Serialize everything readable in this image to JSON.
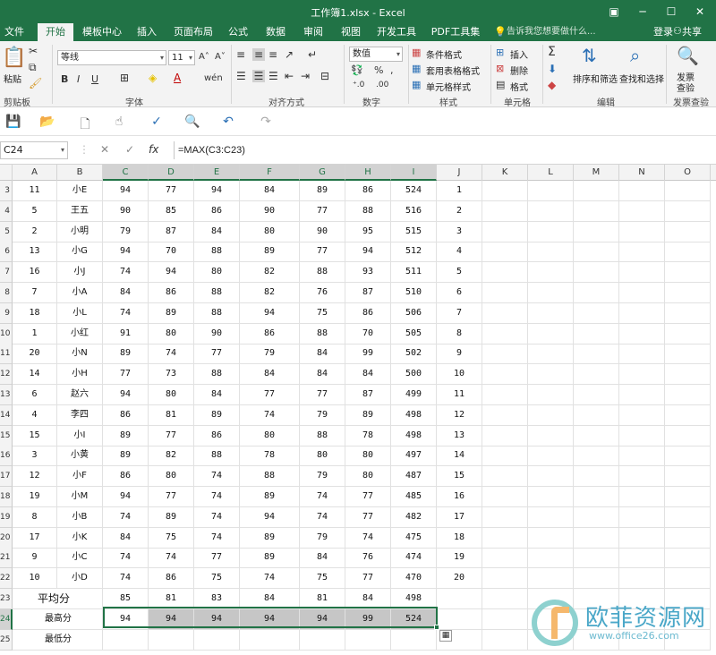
{
  "window": {
    "title": "工作簿1.xlsx - Excel",
    "controls": [
      "▣",
      "─",
      "☐",
      "✕"
    ]
  },
  "ribbon_tabs": [
    "文件",
    "开始",
    "模板中心",
    "插入",
    "页面布局",
    "公式",
    "数据",
    "审阅",
    "视图",
    "开发工具",
    "PDF工具集"
  ],
  "active_tab": "开始",
  "tell_me": "告诉我您想要做什么...",
  "login": "登录",
  "share": "共享",
  "ribbon": {
    "clipboard": {
      "label": "剪贴板",
      "paste": "粘贴"
    },
    "font": {
      "label": "字体",
      "name": "等线",
      "size": "11"
    },
    "alignment": {
      "label": "对齐方式"
    },
    "number": {
      "label": "数字",
      "format": "数值"
    },
    "styles": {
      "label": "样式",
      "conditional": "条件格式",
      "table": "套用表格格式",
      "cell": "单元格样式"
    },
    "cells": {
      "label": "单元格",
      "insert": "插入",
      "delete": "删除",
      "format": "格式"
    },
    "editing": {
      "label": "编辑",
      "sort": "排序和筛选",
      "find": "查找和选择"
    },
    "invoice": {
      "label": "发票查验",
      "btn_line1": "发票",
      "btn_line2": "查验"
    }
  },
  "formula_bar": {
    "name_box": "C24",
    "formula": "=MAX(C3:C23)"
  },
  "columns": [
    "A",
    "B",
    "C",
    "D",
    "E",
    "F",
    "G",
    "H",
    "I",
    "J",
    "K",
    "L",
    "M",
    "N",
    "O"
  ],
  "selected_columns": [
    "C",
    "D",
    "E",
    "F",
    "G",
    "H",
    "I"
  ],
  "rows": [
    {
      "num": "3",
      "cells": [
        "11",
        "小E",
        "94",
        "77",
        "94",
        "84",
        "89",
        "86",
        "524",
        "1"
      ]
    },
    {
      "num": "4",
      "cells": [
        "5",
        "王五",
        "90",
        "85",
        "86",
        "90",
        "77",
        "88",
        "516",
        "2"
      ]
    },
    {
      "num": "5",
      "cells": [
        "2",
        "小明",
        "79",
        "87",
        "84",
        "80",
        "90",
        "95",
        "515",
        "3"
      ]
    },
    {
      "num": "6",
      "cells": [
        "13",
        "小G",
        "94",
        "70",
        "88",
        "89",
        "77",
        "94",
        "512",
        "4"
      ]
    },
    {
      "num": "7",
      "cells": [
        "16",
        "小J",
        "74",
        "94",
        "80",
        "82",
        "88",
        "93",
        "511",
        "5"
      ]
    },
    {
      "num": "8",
      "cells": [
        "7",
        "小A",
        "84",
        "86",
        "88",
        "82",
        "76",
        "87",
        "510",
        "6"
      ]
    },
    {
      "num": "9",
      "cells": [
        "18",
        "小L",
        "74",
        "89",
        "88",
        "94",
        "75",
        "86",
        "506",
        "7"
      ]
    },
    {
      "num": "10",
      "cells": [
        "1",
        "小红",
        "91",
        "80",
        "90",
        "86",
        "88",
        "70",
        "505",
        "8"
      ]
    },
    {
      "num": "11",
      "cells": [
        "20",
        "小N",
        "89",
        "74",
        "77",
        "79",
        "84",
        "99",
        "502",
        "9"
      ]
    },
    {
      "num": "12",
      "cells": [
        "14",
        "小H",
        "77",
        "73",
        "88",
        "84",
        "84",
        "84",
        "500",
        "10"
      ]
    },
    {
      "num": "13",
      "cells": [
        "6",
        "赵六",
        "94",
        "80",
        "84",
        "77",
        "77",
        "87",
        "499",
        "11"
      ]
    },
    {
      "num": "14",
      "cells": [
        "4",
        "李四",
        "86",
        "81",
        "89",
        "74",
        "79",
        "89",
        "498",
        "12"
      ]
    },
    {
      "num": "15",
      "cells": [
        "15",
        "小I",
        "89",
        "77",
        "86",
        "80",
        "88",
        "78",
        "498",
        "13"
      ]
    },
    {
      "num": "16",
      "cells": [
        "3",
        "小黄",
        "89",
        "82",
        "88",
        "78",
        "80",
        "80",
        "497",
        "14"
      ]
    },
    {
      "num": "17",
      "cells": [
        "12",
        "小F",
        "86",
        "80",
        "74",
        "88",
        "79",
        "80",
        "487",
        "15"
      ]
    },
    {
      "num": "18",
      "cells": [
        "19",
        "小M",
        "94",
        "77",
        "74",
        "89",
        "74",
        "77",
        "485",
        "16"
      ]
    },
    {
      "num": "19",
      "cells": [
        "8",
        "小B",
        "74",
        "89",
        "74",
        "94",
        "74",
        "77",
        "482",
        "17"
      ]
    },
    {
      "num": "20",
      "cells": [
        "17",
        "小K",
        "84",
        "75",
        "74",
        "89",
        "79",
        "74",
        "475",
        "18"
      ]
    },
    {
      "num": "21",
      "cells": [
        "9",
        "小C",
        "74",
        "74",
        "77",
        "89",
        "84",
        "76",
        "474",
        "19"
      ]
    },
    {
      "num": "22",
      "cells": [
        "10",
        "小D",
        "74",
        "86",
        "75",
        "74",
        "75",
        "77",
        "470",
        "20"
      ]
    }
  ],
  "summary_rows": [
    {
      "num": "23",
      "label": "平均分",
      "cells": [
        "85",
        "81",
        "83",
        "84",
        "81",
        "84",
        "498"
      ]
    },
    {
      "num": "24",
      "label": "最高分",
      "cells": [
        "94",
        "94",
        "94",
        "94",
        "94",
        "99",
        "524"
      ]
    },
    {
      "num": "25",
      "label": "最低分",
      "cells": []
    }
  ],
  "watermark": {
    "brand": "欧菲资源网",
    "url": "www.office26.com"
  }
}
